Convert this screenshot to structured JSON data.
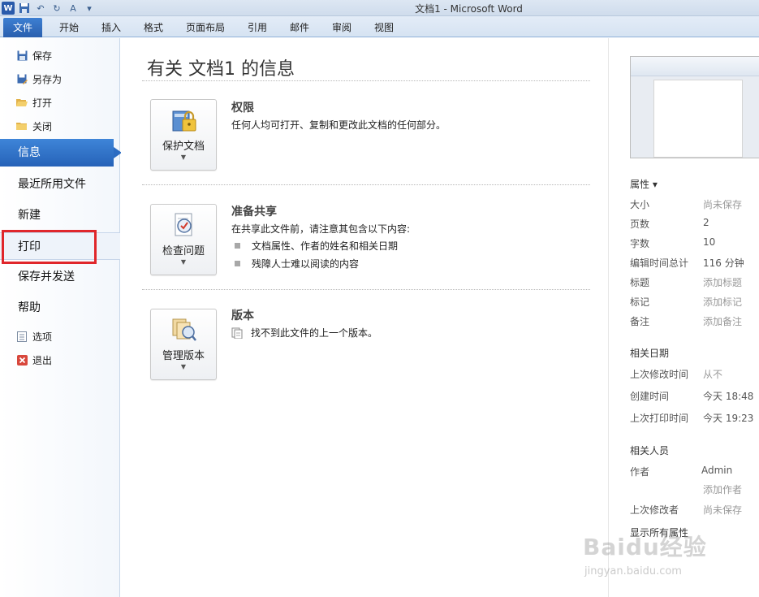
{
  "window": {
    "title": "文档1 - Microsoft Word"
  },
  "ribbon": {
    "file_tab": "文件",
    "tabs": [
      "开始",
      "插入",
      "格式",
      "页面布局",
      "引用",
      "邮件",
      "审阅",
      "视图"
    ]
  },
  "backstage_nav": {
    "small_top": [
      {
        "label": "保存",
        "icon": "save-icon"
      },
      {
        "label": "另存为",
        "icon": "save-as-icon"
      },
      {
        "label": "打开",
        "icon": "open-folder-icon"
      },
      {
        "label": "关闭",
        "icon": "close-folder-icon"
      }
    ],
    "big": [
      {
        "label": "信息",
        "active": true
      },
      {
        "label": "最近所用文件"
      },
      {
        "label": "新建"
      },
      {
        "label": "打印",
        "highlighted": true
      },
      {
        "label": "保存并发送"
      },
      {
        "label": "帮助"
      }
    ],
    "small_bottom": [
      {
        "label": "选项",
        "icon": "options-icon"
      },
      {
        "label": "退出",
        "icon": "exit-icon"
      }
    ]
  },
  "info": {
    "page_title": "有关 文档1 的信息",
    "permissions": {
      "button": "保护文档",
      "title": "权限",
      "text": "任何人均可打开、复制和更改此文档的任何部分。"
    },
    "prepare": {
      "button": "检查问题",
      "title": "准备共享",
      "text": "在共享此文件前，请注意其包含以下内容:",
      "bullets": [
        "文档属性、作者的姓名和相关日期",
        "残障人士难以阅读的内容"
      ]
    },
    "versions": {
      "button": "管理版本",
      "title": "版本",
      "text": "找不到此文件的上一个版本。"
    }
  },
  "properties": {
    "header": "属性 ▾",
    "rows": [
      {
        "key": "大小",
        "value": "尚未保存",
        "muted": true
      },
      {
        "key": "页数",
        "value": "2"
      },
      {
        "key": "字数",
        "value": "10"
      },
      {
        "key": "编辑时间总计",
        "value": "116 分钟"
      },
      {
        "key": "标题",
        "value": "添加标题",
        "muted": true
      },
      {
        "key": "标记",
        "value": "添加标记",
        "muted": true
      },
      {
        "key": "备注",
        "value": "添加备注",
        "muted": true
      }
    ],
    "dates_header": "相关日期",
    "dates": [
      {
        "key": "上次修改时间",
        "value": "从不",
        "muted": true
      },
      {
        "key": "创建时间",
        "value": "今天 18:48"
      },
      {
        "key": "上次打印时间",
        "value": "今天 19:23"
      }
    ],
    "people_header": "相关人员",
    "author_key": "作者",
    "author_value": "Admin",
    "add_author": "添加作者",
    "last_modified_by_key": "上次修改者",
    "last_modified_by_value": "尚未保存",
    "show_all": "显示所有属性"
  },
  "watermark": {
    "main": "Baidu经验",
    "sub": "jingyan.baidu.com"
  },
  "colors": {
    "accent": "#2a5fae",
    "highlight_box": "#e0262b"
  }
}
